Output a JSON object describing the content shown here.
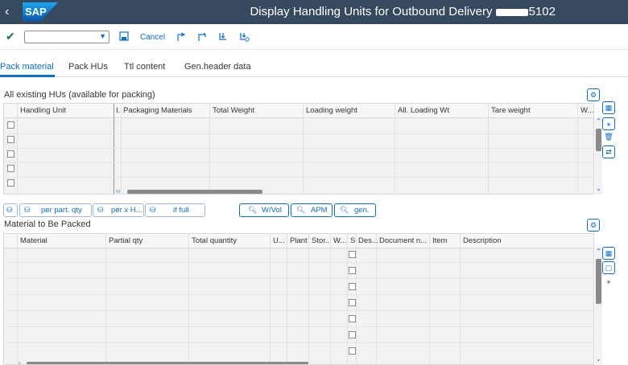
{
  "shell": {
    "back_glyph": "‹",
    "logo_text": "SAP",
    "title_prefix": "Display Handling Units for Outbound Delivery",
    "title_suffix": "5102"
  },
  "toolbar": {
    "cancel_label": "Cancel",
    "combo_value": ""
  },
  "tabs": [
    {
      "label": "Pack material",
      "active": true
    },
    {
      "label": "Pack HUs",
      "active": false
    },
    {
      "label": "Ttl content",
      "active": false
    },
    {
      "label": "Gen.header data",
      "active": false
    }
  ],
  "hu_section": {
    "title": "All existing HUs (available for packing)",
    "columns": [
      "Handling Unit",
      "I.",
      "Packaging Materials",
      "Total Weight",
      "Loading weight",
      "All. Loading Wt",
      "Tare weight",
      "W..."
    ]
  },
  "mid_buttons": {
    "per_part_qty": "per part. qty",
    "per_x_h": "per x H...",
    "if_full": "if full",
    "w_vol": "W/Vol",
    "apm": "APM",
    "gen": "gen."
  },
  "material_section": {
    "title": "Material to Be Packed",
    "columns": [
      "Material",
      "Partial qty",
      "Total quantity",
      "U...",
      "Plant",
      "Stor...",
      "W...",
      "S",
      "Des...",
      "Document n...",
      "Item",
      "Description"
    ]
  },
  "colors": {
    "shell_bg": "#354a5f",
    "accent": "#0a6ed1",
    "check_green": "#107e3e"
  }
}
